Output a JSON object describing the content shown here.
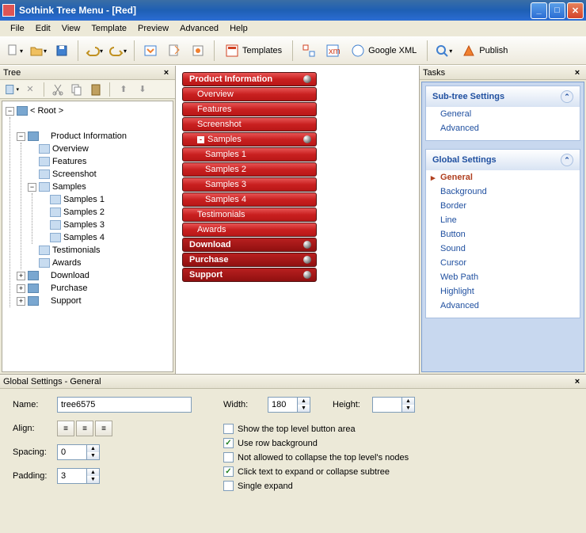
{
  "window": {
    "title": "Sothink Tree Menu - [Red]"
  },
  "menubar": [
    "File",
    "Edit",
    "View",
    "Template",
    "Preview",
    "Advanced",
    "Help"
  ],
  "toolbar": {
    "templates_label": "Templates",
    "google_xml_label": "Google XML",
    "publish_label": "Publish"
  },
  "panels": {
    "tree_title": "Tree",
    "tasks_title": "Tasks",
    "settings_title": "Global Settings - General"
  },
  "tree": {
    "root_label": "< Root >",
    "nodes": [
      {
        "label": "Product Information",
        "expanded": true,
        "children": [
          {
            "label": "Overview"
          },
          {
            "label": "Features"
          },
          {
            "label": "Screenshot"
          },
          {
            "label": "Samples",
            "expanded": true,
            "children": [
              {
                "label": "Samples 1"
              },
              {
                "label": "Samples 2"
              },
              {
                "label": "Samples 3"
              },
              {
                "label": "Samples 4"
              }
            ]
          },
          {
            "label": "Testimonials"
          },
          {
            "label": "Awards"
          }
        ]
      },
      {
        "label": "Download",
        "expanded": false
      },
      {
        "label": "Purchase",
        "expanded": false
      },
      {
        "label": "Support",
        "expanded": false
      }
    ]
  },
  "preview_menu": [
    {
      "label": "Product Information",
      "level": 0,
      "bullet": true
    },
    {
      "label": "Overview",
      "level": 1
    },
    {
      "label": "Features",
      "level": 1
    },
    {
      "label": "Screenshot",
      "level": 1
    },
    {
      "label": "Samples",
      "level": 1,
      "bullet": true,
      "expander": "-"
    },
    {
      "label": "Samples 1",
      "level": 2
    },
    {
      "label": "Samples 2",
      "level": 2
    },
    {
      "label": "Samples 3",
      "level": 2
    },
    {
      "label": "Samples 4",
      "level": 2
    },
    {
      "label": "Testimonials",
      "level": 1
    },
    {
      "label": "Awards",
      "level": 1
    },
    {
      "label": "Download",
      "level": 0,
      "dark": true,
      "bullet": true
    },
    {
      "label": "Purchase",
      "level": 0,
      "dark": true,
      "bullet": true
    },
    {
      "label": "Support",
      "level": 0,
      "dark": true,
      "bullet": true
    }
  ],
  "tasks": {
    "subtree": {
      "title": "Sub-tree Settings",
      "items": [
        "General",
        "Advanced"
      ]
    },
    "global": {
      "title": "Global Settings",
      "items": [
        "General",
        "Background",
        "Border",
        "Line",
        "Button",
        "Sound",
        "Cursor",
        "Web Path",
        "Highlight",
        "Advanced"
      ],
      "active": 0
    }
  },
  "settings": {
    "name_label": "Name:",
    "name_value": "tree6575",
    "align_label": "Align:",
    "spacing_label": "Spacing:",
    "spacing_value": "0",
    "padding_label": "Padding:",
    "padding_value": "3",
    "width_label": "Width:",
    "width_value": "180",
    "height_label": "Height:",
    "height_value": "",
    "checkboxes": [
      {
        "label": "Show the top level button area",
        "checked": false
      },
      {
        "label": "Use row background",
        "checked": true
      },
      {
        "label": "Not allowed to collapse the top level's nodes",
        "checked": false
      },
      {
        "label": "Click text to expand or collapse subtree",
        "checked": true
      },
      {
        "label": "Single expand",
        "checked": false
      }
    ]
  }
}
